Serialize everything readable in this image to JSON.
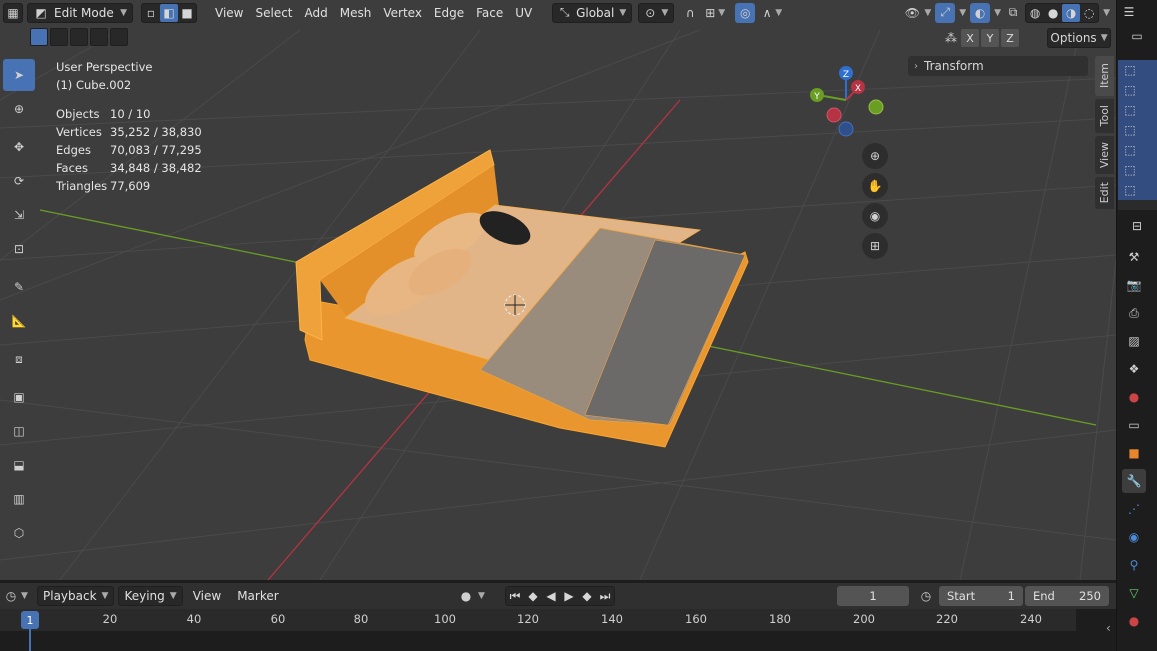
{
  "header": {
    "mode": "Edit Mode",
    "menus": [
      "View",
      "Select",
      "Add",
      "Mesh",
      "Vertex",
      "Edge",
      "Face",
      "UV"
    ],
    "orientation": "Global",
    "options_label": "Options",
    "axes": [
      "X",
      "Y",
      "Z"
    ]
  },
  "overlay": {
    "view_name": "User Perspective",
    "object_name": "(1) Cube.002",
    "stats": [
      {
        "label": "Objects",
        "value": "10 / 10"
      },
      {
        "label": "Vertices",
        "value": "35,252 / 38,830"
      },
      {
        "label": "Edges",
        "value": "70,083 / 77,295"
      },
      {
        "label": "Faces",
        "value": "34,848 / 38,482"
      },
      {
        "label": "Triangles",
        "value": "77,609"
      }
    ]
  },
  "panel": {
    "transform_label": "Transform"
  },
  "gizmo": {
    "x": "X",
    "y": "Y",
    "z": "Z"
  },
  "sidebar_tabs": [
    "Item",
    "Tool",
    "View",
    "Edit"
  ],
  "timeline": {
    "menus": [
      "Playback",
      "Keying",
      "View",
      "Marker"
    ],
    "current_frame": "1",
    "start_label": "Start",
    "start_value": "1",
    "end_label": "End",
    "end_value": "250",
    "ticks": [
      "20",
      "40",
      "60",
      "80",
      "100",
      "120",
      "140",
      "160",
      "180",
      "200",
      "220",
      "240"
    ],
    "playhead_label": "1"
  },
  "colors": {
    "accent": "#4772b3",
    "selection": "#ffa52b",
    "x_axis": "#b53343",
    "y_axis": "#6a9d23",
    "z_axis": "#2f6fd1"
  }
}
